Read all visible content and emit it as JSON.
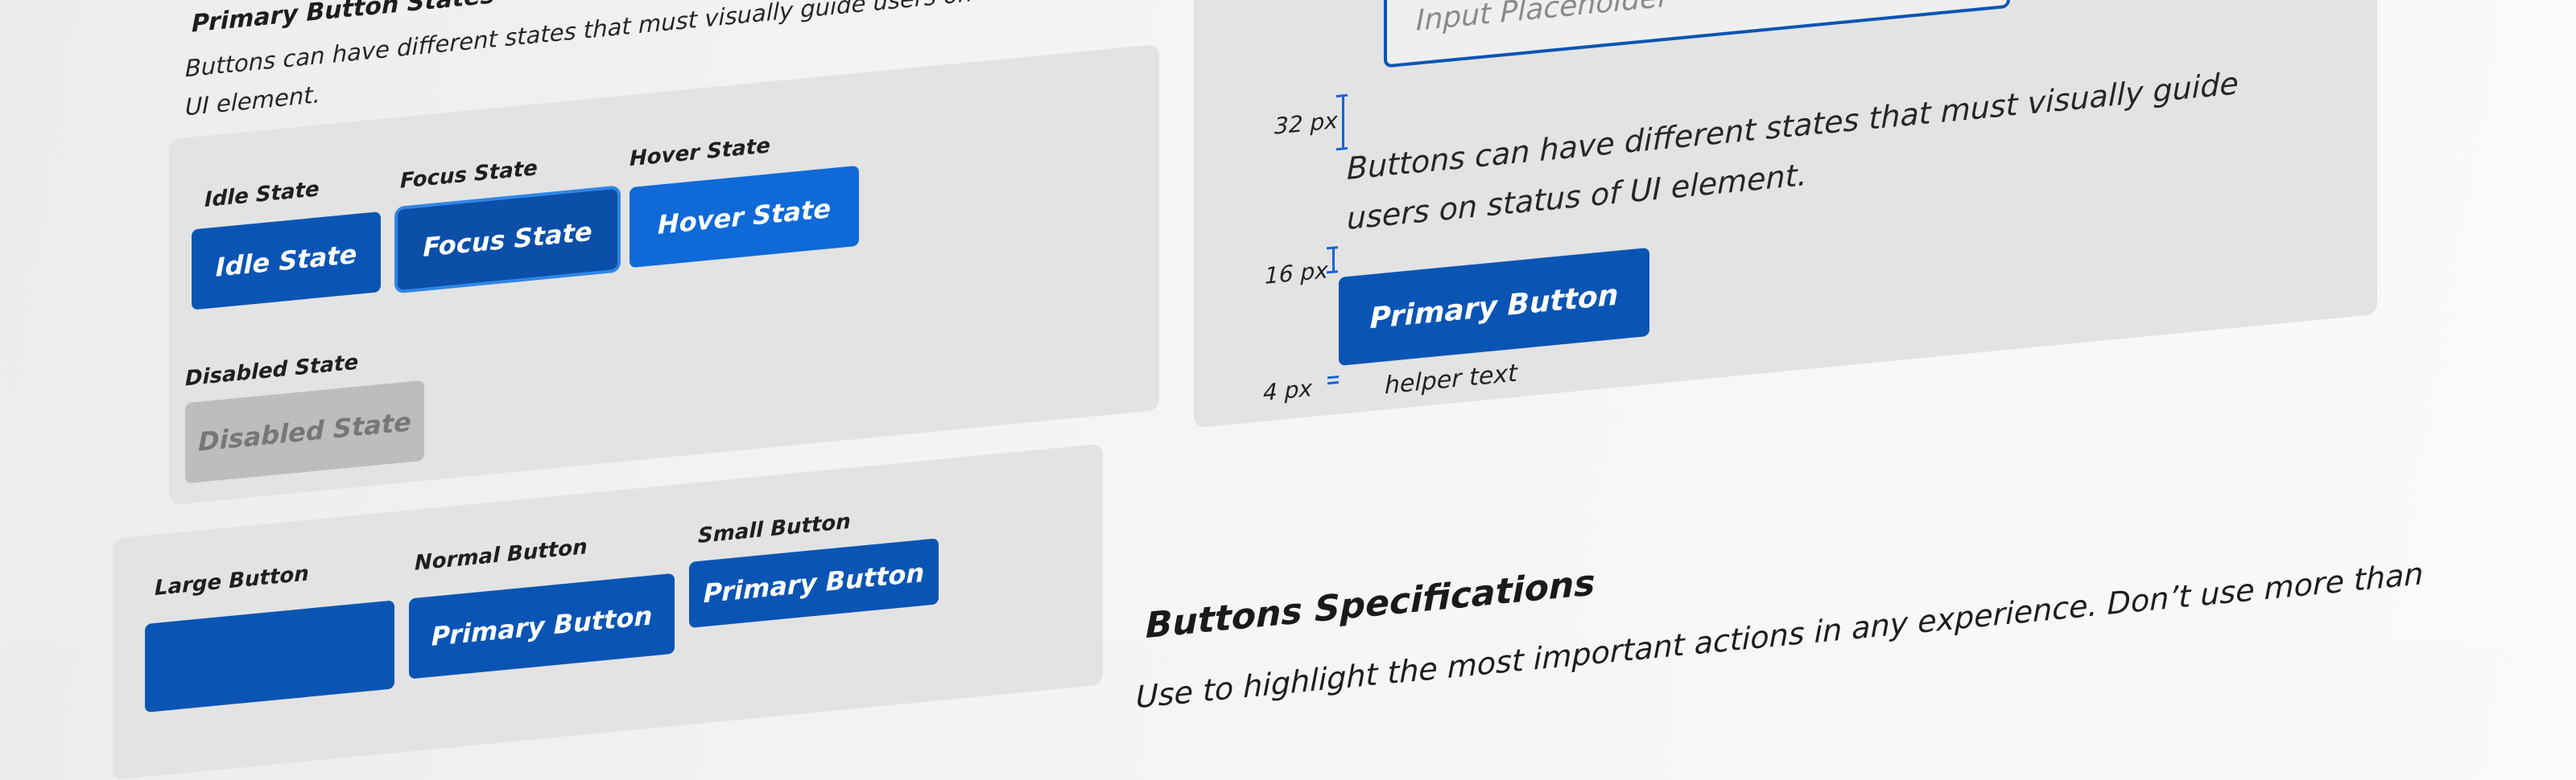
{
  "primary_states": {
    "heading": "Primary Button States",
    "description": "Buttons can have different states that must visually guide users on status of UI element.",
    "idle_label": "Idle State",
    "focus_label": "Focus State",
    "hover_label": "Hover State",
    "disabled_label": "Disabled State",
    "idle_button": "Idle State",
    "focus_button": "Focus State",
    "hover_button": "Hover State",
    "disabled_button": "Disabled State"
  },
  "sizes": {
    "large_label": "Large Button",
    "normal_label": "Normal Button",
    "small_label": "Small Button",
    "normal_button": "Primary Button",
    "small_button": "Primary Button"
  },
  "spacing": {
    "input_placeholder": "Input Placeholder",
    "gap_32": "32 px",
    "gap_16": "16 px",
    "gap_4": "4 px",
    "description": "Buttons can have different states that must visually guide users on status of UI element.",
    "primary_button": "Primary Button",
    "helper_text": "helper text"
  },
  "specifications": {
    "title": "Buttons Specifications",
    "text": "Use to highlight the most important actions in any experience. Don’t use more than"
  },
  "colors": {
    "primary": "#0a55b4",
    "focus_ring": "#2f86e6",
    "hover": "#0f6ad8",
    "disabled": "#bdbdbd",
    "card": "#e3e3e3"
  }
}
